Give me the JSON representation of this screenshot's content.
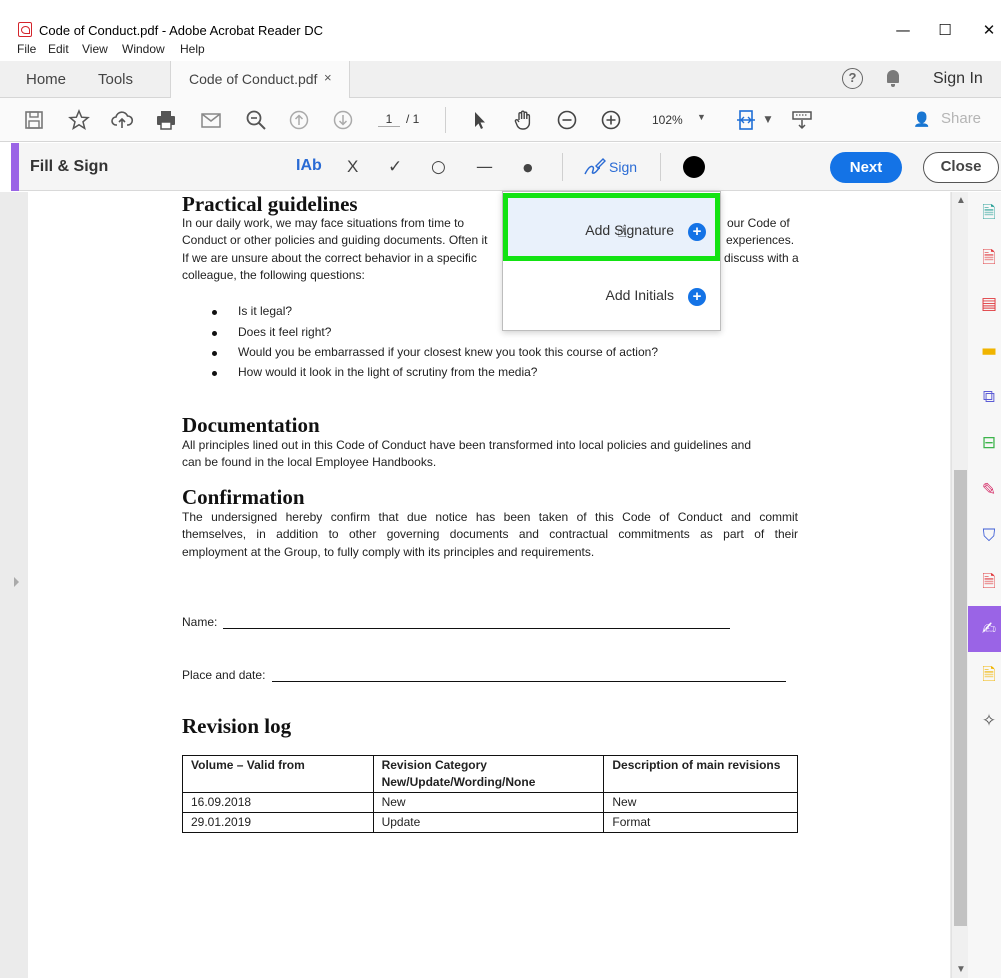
{
  "window": {
    "title": "Code of Conduct.pdf - Adobe Acrobat Reader DC",
    "minimize": "—",
    "maximize": "☐",
    "close": "✕"
  },
  "menu": [
    "File",
    "Edit",
    "View",
    "Window",
    "Help"
  ],
  "tabs": {
    "home": "Home",
    "tools": "Tools",
    "document": "Code of Conduct.pdf",
    "document_close": "×",
    "help": "?",
    "sign_in": "Sign In"
  },
  "toolbar": {
    "page_current": "1",
    "page_total": "/ 1",
    "zoom": "102%",
    "share": "Share",
    "icons": [
      "save-icon",
      "bookmark-star-icon",
      "upload-cloud-icon",
      "print-icon",
      "email-icon",
      "zoom-search-icon",
      "page-up-icon",
      "page-down-icon",
      "select-arrow-icon",
      "hand-icon",
      "zoom-out-icon",
      "zoom-in-icon",
      "page-fit-icon",
      "scroll-mode-icon"
    ]
  },
  "fill_sign": {
    "title": "Fill & Sign",
    "text_tool": "IAb",
    "cross_tool": "X",
    "check_tool": "✓",
    "circle_tool": "○",
    "line_tool": "—",
    "dot_tool": "●",
    "sign": "Sign",
    "next": "Next",
    "close": "Close",
    "color": "#000000"
  },
  "dropdown": {
    "add_signature": "Add Signature",
    "add_initials": "Add Initials",
    "plus": "+"
  },
  "document": {
    "practical": {
      "heading": "Practical guidelines",
      "l1a": "In our daily work, we may face situations from time to",
      "l1b": "our Code of",
      "l2a": "Conduct or other policies and guiding documents. Often it",
      "l2b": "experiences.",
      "l3a": "If we are unsure about the correct behavior in a specific",
      "l3b": "discuss with a",
      "l4": "colleague, the following questions:",
      "bullets": [
        "Is it legal?",
        "Does it feel right?",
        "Would you be embarrassed if your closest knew you took this course of action?",
        "How would it look in the light of scrutiny from the media?"
      ]
    },
    "documentation": {
      "heading": "Documentation",
      "l1": "All principles lined out in this Code of Conduct have been transformed into local policies and guidelines and",
      "l2": "can be found in the local Employee Handbooks."
    },
    "confirmation": {
      "heading": "Confirmation",
      "l1": "The undersigned hereby confirm that due notice has been taken of this Code of Conduct and commit",
      "l2": "themselves, in addition to other governing documents and contractual commitments as part of their",
      "l3": "employment at the Group, to fully comply with its principles and requirements."
    },
    "name_label": "Name:",
    "place_label": "Place and date:",
    "revision": {
      "heading": "Revision log",
      "headers": [
        "Volume – Valid from",
        "Revision Category",
        "New/Update/Wording/None",
        "Description of main revisions"
      ],
      "rows": [
        [
          "16.09.2018",
          "New",
          "New"
        ],
        [
          "29.01.2019",
          "Update",
          "Format"
        ]
      ]
    }
  },
  "colors": {
    "accent_purple": "#9a64e6",
    "next_blue": "#1473e6",
    "highlight_green": "#12e312"
  }
}
